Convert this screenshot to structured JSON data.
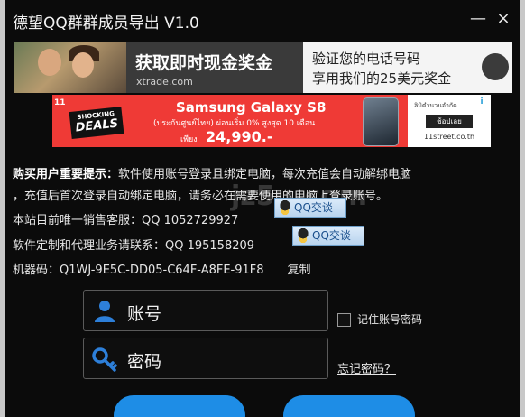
{
  "window": {
    "title": "德望QQ群群成员导出 V1.0",
    "minimize_glyph": "—",
    "close_glyph": "×"
  },
  "ad_top": {
    "headline": "获取即时现金奖金",
    "site": "xtrade.com",
    "line1": "验证您的电话号码",
    "line2": "享用我们的25美元奖金"
  },
  "ad_banner": {
    "logo": "11",
    "badge_line1": "SHOCKING",
    "badge_line2": "DEALS",
    "title": "Samsung Galaxy S8",
    "subtitle": "(ประกันศูนย์ไทย) ผ่อนเริ่ม 0% สูงสุด 10 เดือน",
    "price_prefix": "เพียง",
    "price": "24,990.-",
    "right_line1": "ลิมิตำนวนจำกัด",
    "right_button": "ช้อปเลย",
    "right_line2": "11street.co.th",
    "info": "i"
  },
  "notice": {
    "label": "购买用户重要提示：",
    "text1": "软件使用账号登录且绑定电脑，每次充值会自动解绑电脑",
    "text2": "，充值后首次登录自动绑定电脑，请务必在需要使用的电脑上登录账号。",
    "sales": "本站目前唯一销售客服：QQ 1052729927",
    "agency": "软件定制和代理业务请联系：QQ 195158209",
    "machine_code": "机器码：Q1WJ-9E5C-DD05-C64F-A8FE-91F8",
    "copy": "复制",
    "watermark": "jz5u.com"
  },
  "qq_buttons": {
    "chat1": "QQ交谈",
    "chat2": "QQ交谈"
  },
  "login": {
    "account_label": "账号",
    "password_label": "密码",
    "remember": "记住账号密码",
    "forgot": "忘记密码？"
  },
  "colors": {
    "background": "#0b0b0b",
    "accent": "#1e8de6",
    "ad_red": "#ef3a36"
  }
}
